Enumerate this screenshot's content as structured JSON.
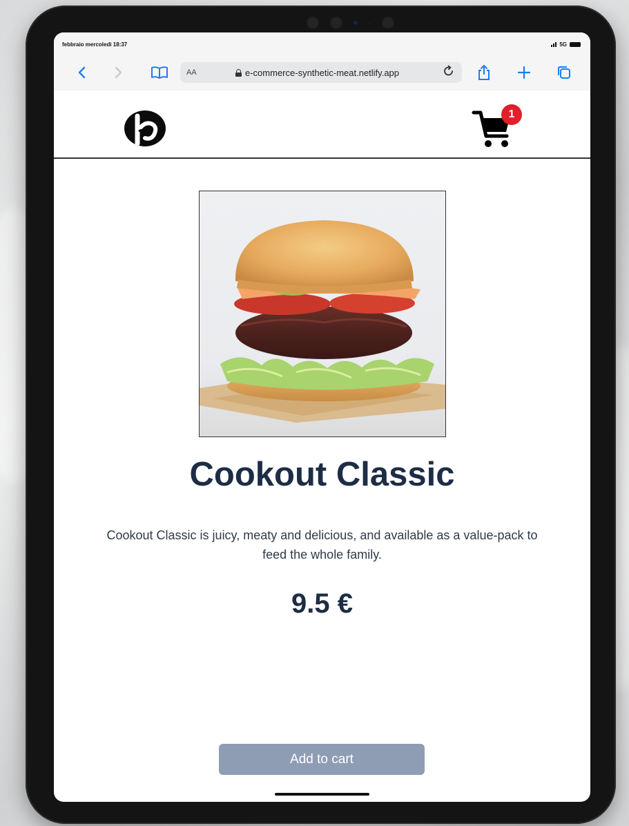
{
  "device": {
    "status_bar": {
      "datetime": "febbraio mercoledì 18:37",
      "network": "5G"
    }
  },
  "browser": {
    "text_size_label": "AA",
    "url": "e-commerce-synthetic-meat.netlify.app",
    "icons": {
      "back": "chevron-left-icon",
      "forward": "chevron-right-icon",
      "bookmarks": "book-icon",
      "reload": "reload-icon",
      "share": "share-icon",
      "new_tab": "plus-icon",
      "tabs": "tabs-icon"
    },
    "accent_color": "#1a7cf0"
  },
  "header": {
    "logo": "brand-logo-icon",
    "cart": {
      "icon": "shopping-cart-icon",
      "count": "1",
      "badge_color": "#e0202a"
    }
  },
  "product": {
    "image": "burger-photo",
    "title": "Cookout Classic",
    "description": "Cookout Classic is juicy, meaty and delicious, and available as a value-pack to feed the whole family.",
    "price": "9.5 €",
    "add_to_cart_label": "Add to cart",
    "title_color": "#1d2d45",
    "button_color": "#8e9db4"
  }
}
